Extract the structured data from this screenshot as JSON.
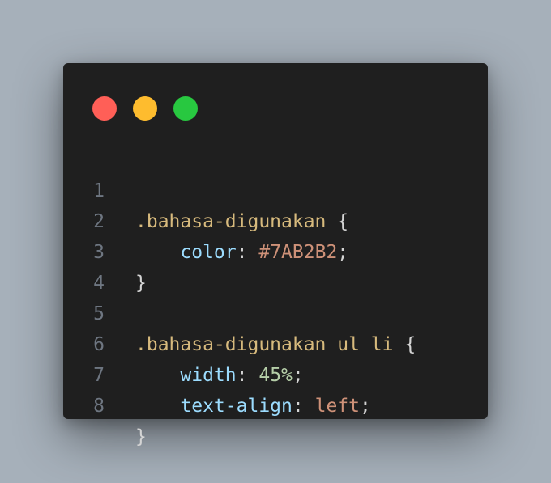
{
  "window": {
    "controls": [
      {
        "name": "close",
        "color": "#ff5f57"
      },
      {
        "name": "minimize",
        "color": "#febc2e"
      },
      {
        "name": "maximize",
        "color": "#28c840"
      }
    ]
  },
  "code": {
    "lines": [
      {
        "number": "1",
        "selector": ".bahasa-digunakan",
        "brace": "{"
      },
      {
        "number": "2",
        "property": "color",
        "colon": ":",
        "value": "#7AB2B2",
        "semi": ";"
      },
      {
        "number": "3",
        "brace": "}"
      },
      {
        "number": "4"
      },
      {
        "number": "5",
        "selector": ".bahasa-digunakan ul li",
        "brace": "{"
      },
      {
        "number": "6",
        "property": "width",
        "colon": ":",
        "value": "45%",
        "semi": ";"
      },
      {
        "number": "7",
        "property": "text-align",
        "colon": ":",
        "value": "left",
        "semi": ";"
      },
      {
        "number": "8",
        "brace": "}"
      }
    ]
  }
}
